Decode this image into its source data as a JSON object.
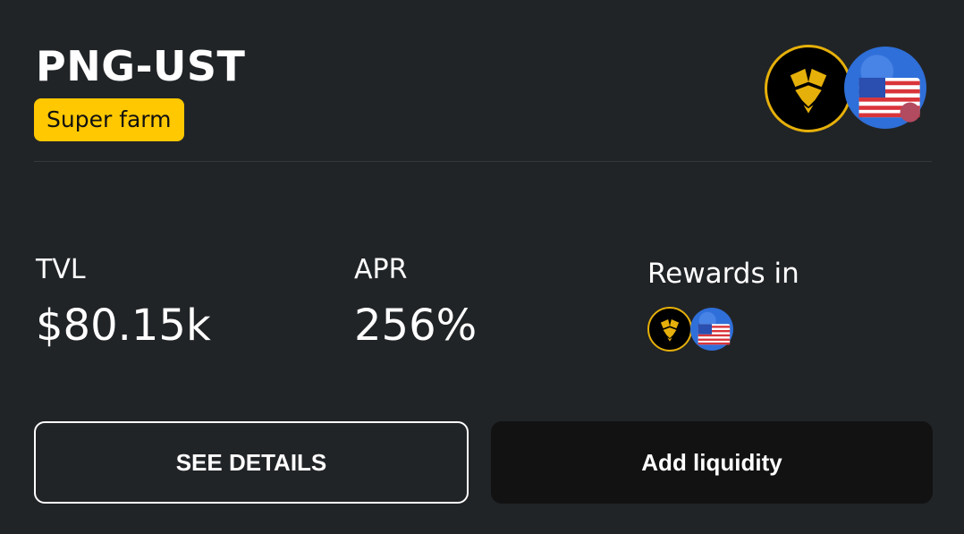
{
  "farm": {
    "pair": "PNG-UST",
    "badge": "Super farm",
    "tokens": [
      {
        "symbol": "PNG",
        "icon": "png-token-icon",
        "color": "#e6b00a"
      },
      {
        "symbol": "UST",
        "icon": "ust-token-icon",
        "color": "#2f6fd9"
      }
    ]
  },
  "stats": {
    "tvl_label": "TVL",
    "tvl_value": "$80.15k",
    "apr_label": "APR",
    "apr_value": "256%",
    "rewards_label": "Rewards in"
  },
  "actions": {
    "see_details": "SEE DETAILS",
    "add_liquidity": "Add liquidity"
  },
  "colors": {
    "background": "#212427",
    "badge": "#ffc800",
    "accent_gold": "#e6b00a",
    "button_dark": "#121212"
  }
}
